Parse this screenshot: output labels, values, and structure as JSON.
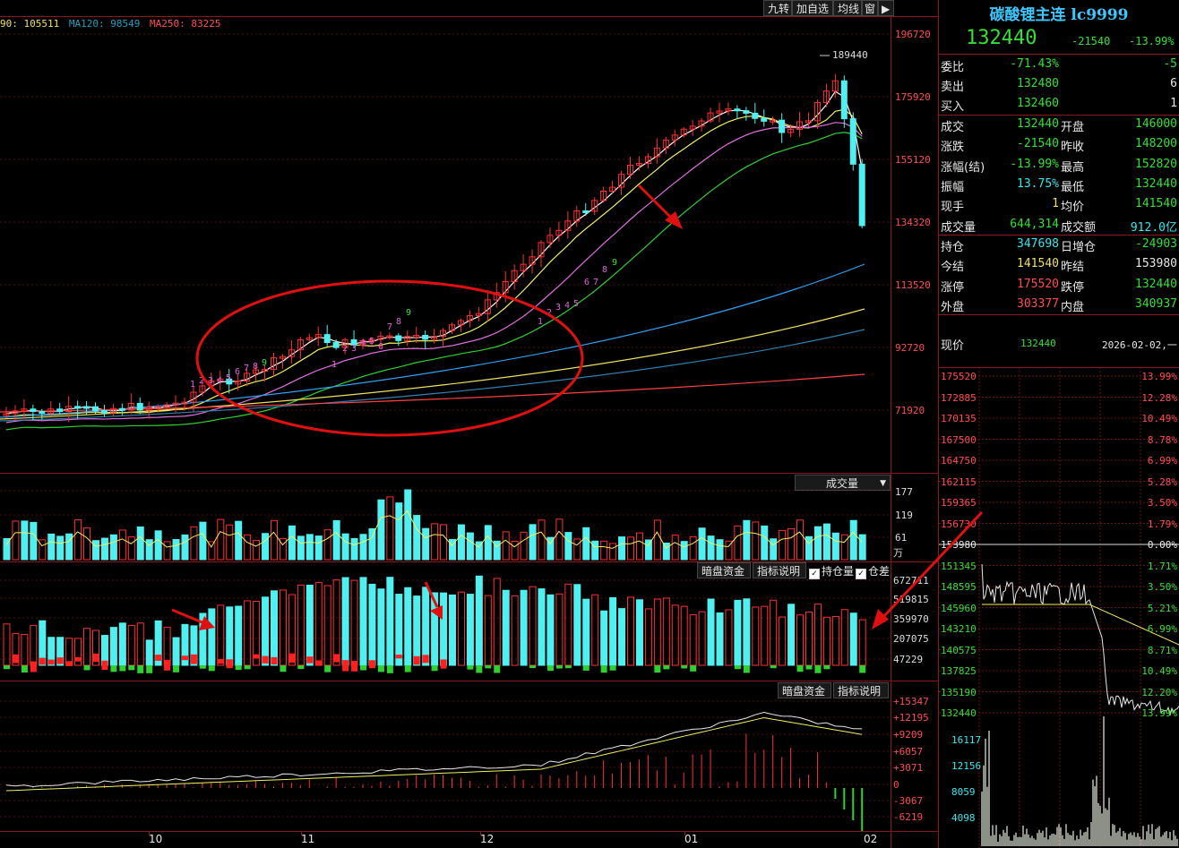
{
  "toolbar": {
    "items": [
      "九转",
      "加自选",
      "均线",
      "窗"
    ]
  },
  "ma_legend": {
    "ma90": "90: 105511",
    "ma120": "MA120: 98549",
    "ma250": "MA250: 83225"
  },
  "price_axis": [
    "196720",
    "175920",
    "155120",
    "134320",
    "113520",
    "92720",
    "71920"
  ],
  "peak_label": "189440",
  "vol_panel": {
    "selector": "成交量",
    "ticks": [
      "177",
      "119",
      "61",
      "万"
    ]
  },
  "oi_panel": {
    "btn1": "暗盘资金",
    "btn2": "指标说明",
    "chk1": "持仓量",
    "chk2": "仓差",
    "ticks": [
      "672711",
      "519815",
      "359970",
      "207075",
      "47229"
    ]
  },
  "money_panel": {
    "btn1": "暗盘资金",
    "btn2": "指标说明",
    "ticks": [
      "+15347",
      "+12195",
      "+9209",
      "+6057",
      "+3071",
      "0",
      "-3067",
      "-6219"
    ]
  },
  "x_axis": [
    "10",
    "11",
    "12",
    "01",
    "02"
  ],
  "quote": {
    "title": "碳酸锂主连 lc9999",
    "last": "132440",
    "change": "-21540",
    "pct": "-13.99%",
    "rows": [
      {
        "l1": "委比",
        "v1": "-71.43%",
        "l2": "",
        "v2": "-5"
      },
      {
        "l1": "卖出",
        "v1": "132480",
        "l2": "",
        "v2": "6"
      },
      {
        "l1": "买入",
        "v1": "132460",
        "l2": "",
        "v2": "1"
      },
      {
        "l1": "成交",
        "v1": "132440",
        "l2": "开盘",
        "v2": "146000"
      },
      {
        "l1": "涨跌",
        "v1": "-21540",
        "l2": "昨收",
        "v2": "148200"
      },
      {
        "l1": "涨幅(结)",
        "v1": "-13.99%",
        "l2": "最高",
        "v2": "152820"
      },
      {
        "l1": "振幅",
        "v1": "13.75%",
        "l2": "最低",
        "v2": "132440"
      },
      {
        "l1": "现手",
        "v1": "1",
        "l2": "均价",
        "v2": "141540"
      },
      {
        "l1": "成交量",
        "v1": "644,314",
        "l2": "成交额",
        "v2": "912.0亿"
      },
      {
        "l1": "持仓",
        "v1": "347698",
        "l2": "日增仓",
        "v2": "-24903"
      },
      {
        "l1": "今结",
        "v1": "141540",
        "l2": "昨结",
        "v2": "153980"
      },
      {
        "l1": "涨停",
        "v1": "175520",
        "l2": "跌停",
        "v2": "132440"
      },
      {
        "l1": "外盘",
        "v1": "303377",
        "l2": "内盘",
        "v2": "340937"
      }
    ]
  },
  "intraday": {
    "label": "现价",
    "price": "132440",
    "date": "2026-02-02,一",
    "left_axis": [
      "175520",
      "172885",
      "170135",
      "167500",
      "164750",
      "162115",
      "159365",
      "156730",
      "153980",
      "151345",
      "148595",
      "145960",
      "143210",
      "140575",
      "137825",
      "135190",
      "132440"
    ],
    "right_axis": [
      "13.99%",
      "12.28%",
      "10.49%",
      "8.78%",
      "6.99%",
      "5.28%",
      "3.50%",
      "1.79%",
      "0.00%",
      "1.71%",
      "3.50%",
      "5.21%",
      "6.99%",
      "8.71%",
      "10.49%",
      "12.20%",
      "13.99%"
    ],
    "vol_axis": [
      "16117",
      "12156",
      "8059",
      "4098"
    ]
  },
  "colors": {
    "up": "#ff3030",
    "down": "#50f0f0",
    "ma5": "#ffffff",
    "ma10": "#f0f060",
    "ma20": "#e070e0",
    "ma30": "#30d030",
    "ma60": "#30a0f0",
    "accent_title": "#3cc8ff"
  }
}
